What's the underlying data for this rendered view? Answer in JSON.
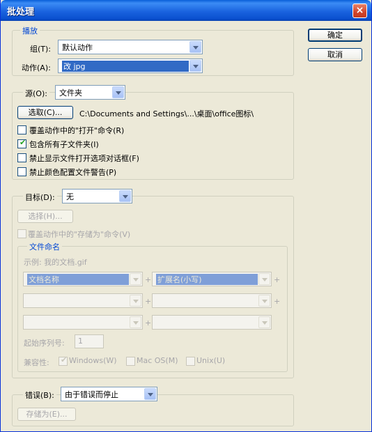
{
  "window": {
    "title": "批处理",
    "close_glyph": "×"
  },
  "play": {
    "legend": "播放",
    "group_label": "组(T):",
    "group_value": "默认动作",
    "action_label": "动作(A):",
    "action_value": "改 jpg"
  },
  "source": {
    "label": "源(O):",
    "value": "文件夹",
    "choose_button": "选取(C)...",
    "path": "C:\\Documents and Settings\\...\\桌面\\office图标\\",
    "checkboxes": [
      {
        "label": "覆盖动作中的\"打开\"命令(R)",
        "checked": false
      },
      {
        "label": "包含所有子文件夹(I)",
        "checked": true
      },
      {
        "label": "禁止显示文件打开选项对话框(F)",
        "checked": false
      },
      {
        "label": "禁止颜色配置文件警告(P)",
        "checked": false
      }
    ]
  },
  "target": {
    "label": "目标(D):",
    "value": "无",
    "choose_button": "选择(H)...",
    "override_save": "覆盖动作中的\"存储为\"命令(V)",
    "naming": {
      "legend": "文件命名",
      "example": "示例: 我的文档.gif",
      "slot1": "文档名称",
      "slot2": "扩展名(小写)",
      "plus": "+",
      "serial_label": "起始序列号:",
      "serial_value": "1",
      "compat_label": "兼容性:",
      "compat": [
        {
          "label": "Windows(W)",
          "checked": true
        },
        {
          "label": "Mac OS(M)",
          "checked": false
        },
        {
          "label": "Unix(U)",
          "checked": false
        }
      ]
    }
  },
  "errors": {
    "label": "错误(B):",
    "value": "由于错误而停止",
    "save_as_button": "存储为(E)..."
  },
  "buttons": {
    "ok": "确定",
    "cancel": "取消"
  },
  "colors": {
    "title_bar": "#1a63df",
    "accent_blue": "#0046d5",
    "window_bg": "#ece9d8"
  }
}
